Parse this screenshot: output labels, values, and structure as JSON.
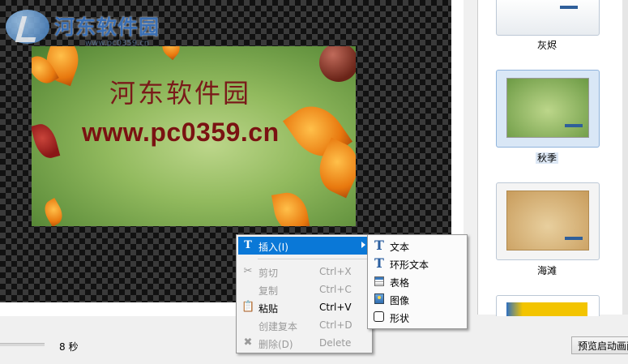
{
  "logo": {
    "text": "河东软件园",
    "url": "www.pc0359.cn"
  },
  "slide": {
    "title": "河东软件园",
    "url": "www.pc0359.cn"
  },
  "templates": [
    {
      "label": "灰烬",
      "selected": false
    },
    {
      "label": "秋季",
      "selected": true
    },
    {
      "label": "海滩",
      "selected": false
    }
  ],
  "status": {
    "duration": "8 秒",
    "preview_label": "预览启动画面"
  },
  "context_menu": {
    "items": [
      {
        "label": "插入(I)",
        "shortcut": "",
        "enabled": true,
        "highlighted": true,
        "icon": "text-insert-icon"
      },
      {
        "label": "剪切",
        "shortcut": "Ctrl+X",
        "enabled": false,
        "icon": "scissors-icon"
      },
      {
        "label": "复制",
        "shortcut": "Ctrl+C",
        "enabled": false,
        "icon": ""
      },
      {
        "label": "粘贴",
        "shortcut": "Ctrl+V",
        "enabled": true,
        "icon": "clipboard-icon"
      },
      {
        "label": "创建复本",
        "shortcut": "Ctrl+D",
        "enabled": false,
        "icon": ""
      },
      {
        "label": "删除(D)",
        "shortcut": "Delete",
        "enabled": false,
        "icon": "delete-icon"
      }
    ]
  },
  "submenu": {
    "items": [
      {
        "label": "文本",
        "icon": "text-icon"
      },
      {
        "label": "环形文本",
        "icon": "ring-text-icon"
      },
      {
        "label": "表格",
        "icon": "table-icon"
      },
      {
        "label": "图像",
        "icon": "image-icon"
      },
      {
        "label": "形状",
        "icon": "shape-icon"
      }
    ]
  },
  "colors": {
    "menu_highlight": "#0a78d7",
    "disabled_text": "#9a9a9a",
    "slide_text": "#7a1212",
    "logo_blue": "#3a6fb4"
  }
}
